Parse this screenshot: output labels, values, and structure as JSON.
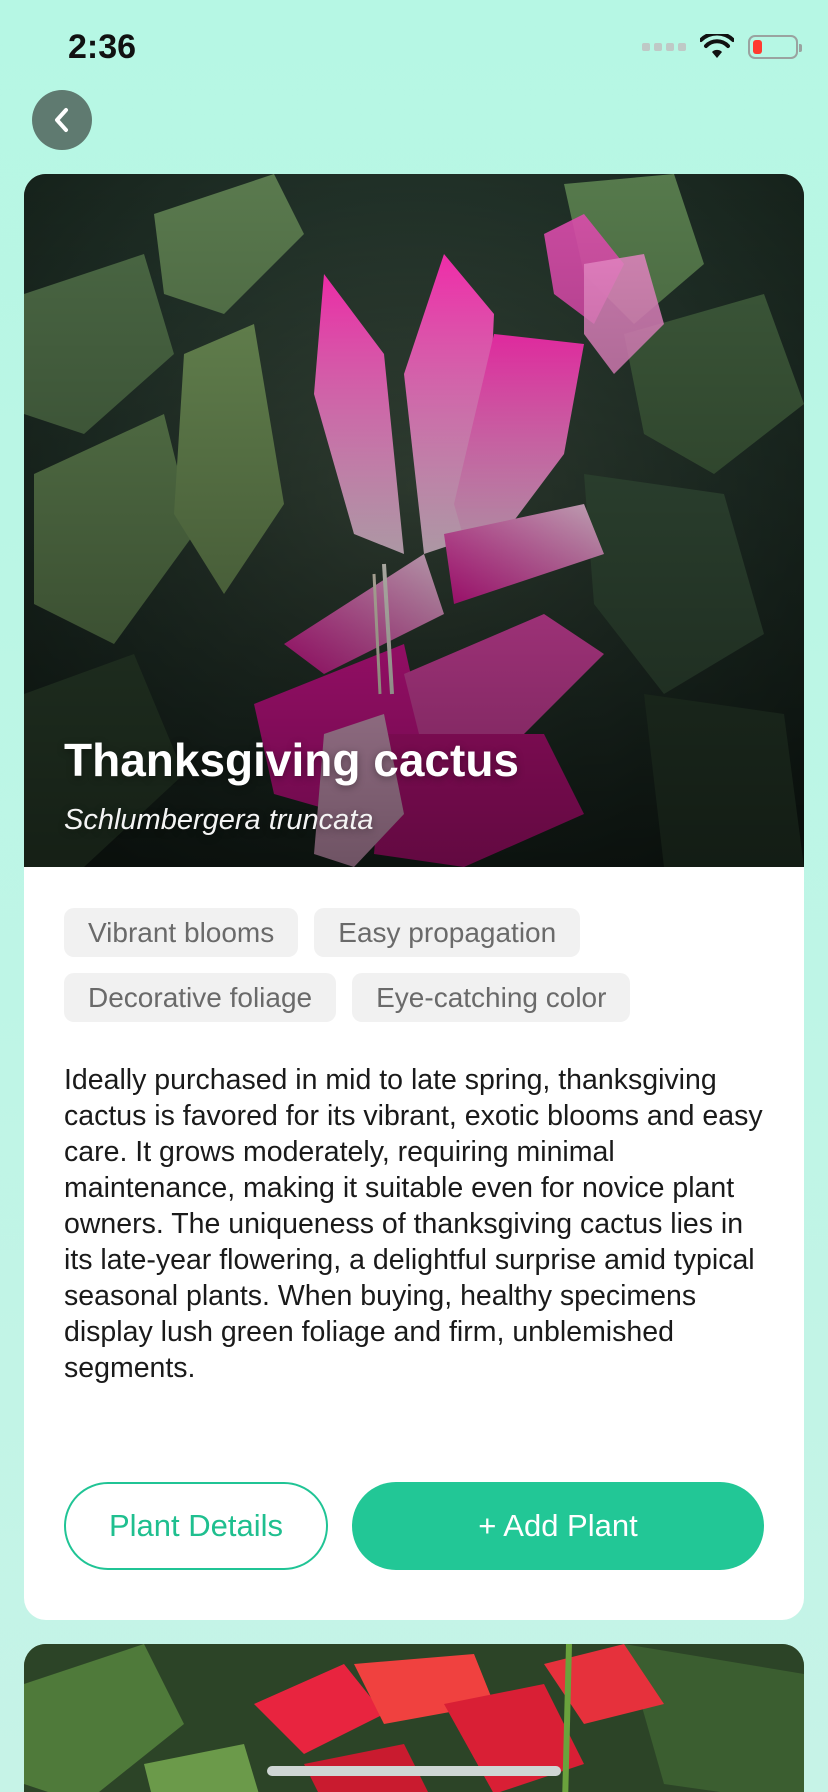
{
  "status_bar": {
    "time": "2:36"
  },
  "back_button": {
    "icon": "chevron-left-icon"
  },
  "plant": {
    "title": "Thanksgiving cactus",
    "scientific_name": "Schlumbergera truncata",
    "tags": [
      "Vibrant blooms",
      "Easy propagation",
      "Decorative foliage",
      "Eye-catching color"
    ],
    "description": "Ideally purchased in mid to late spring, thanksgiving cactus is favored for its vibrant, exotic blooms and easy care. It grows moderately, requiring minimal maintenance, making it suitable even for novice plant owners. The uniqueness of thanksgiving cactus lies in its late-year flowering, a delightful surprise amid typical seasonal plants. When buying, healthy specimens display lush green foliage and firm, unblemished segments.",
    "details_label": "Plant Details",
    "add_label": "+ Add Plant"
  },
  "colors": {
    "accent": "#22c796",
    "background": "#b6f7e4"
  }
}
